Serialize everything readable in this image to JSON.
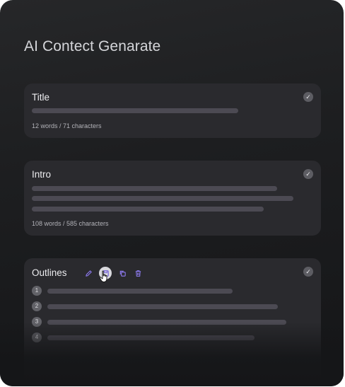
{
  "app": {
    "title": "AI Contect Genarate"
  },
  "cards": {
    "title_card": {
      "heading": "Title",
      "stats": "12 words / 71 characters"
    },
    "intro_card": {
      "heading": "Intro",
      "stats": "108 words / 585 characters"
    },
    "outlines_card": {
      "heading": "Outlines",
      "items": [
        {
          "number": "1"
        },
        {
          "number": "2"
        },
        {
          "number": "3"
        },
        {
          "number": "4"
        }
      ]
    }
  },
  "icons": {
    "check": "check-icon",
    "edit": "pencil-icon",
    "save": "save-icon",
    "copy": "copy-icon",
    "delete": "trash-icon"
  },
  "colors": {
    "background": "#1d1e20",
    "card": "#2a2a2e",
    "placeholder_bar": "#4c4a53",
    "accent": "#8f7cf3"
  }
}
